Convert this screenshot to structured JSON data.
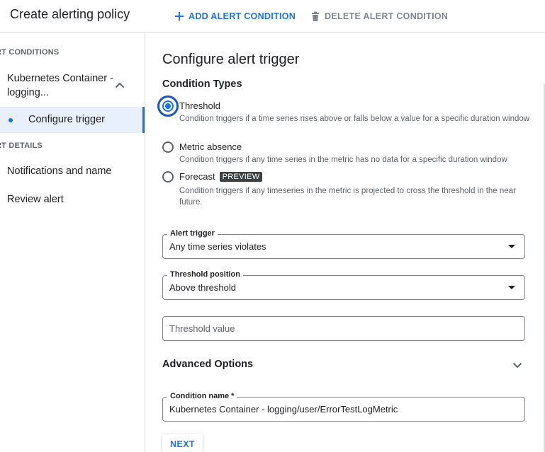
{
  "header": {
    "title": "Create alerting policy",
    "add_condition_label": "ADD ALERT CONDITION",
    "delete_condition_label": "DELETE ALERT CONDITION"
  },
  "sidebar": {
    "conditions_header": "RT CONDITIONS",
    "condition_name": "Kubernetes Container - logging...",
    "active_step": "Configure trigger",
    "details_header": "RT DETAILS",
    "items": [
      {
        "label": "Notifications and name"
      },
      {
        "label": "Review alert"
      }
    ]
  },
  "main": {
    "title": "Configure alert trigger",
    "condition_types_title": "Condition Types",
    "condition_types": [
      {
        "label": "Threshold",
        "description": "Condition triggers if a time series rises above or falls below a value for a specific duration window",
        "selected": true
      },
      {
        "label": "Metric absence",
        "description": "Condition triggers if any time series in the metric has no data for a specific duration window",
        "selected": false
      },
      {
        "label": "Forecast",
        "badge": "PREVIEW",
        "description": "Condition triggers if any timeseries in the metric is projected to cross the threshold in the near future.",
        "selected": false
      }
    ],
    "alert_trigger": {
      "label": "Alert trigger",
      "value": "Any time series violates"
    },
    "threshold_position": {
      "label": "Threshold position",
      "value": "Above threshold"
    },
    "threshold_value": {
      "placeholder": "Threshold value",
      "value": ""
    },
    "advanced_options_label": "Advanced Options",
    "condition_name": {
      "label": "Condition name *",
      "value": "Kubernetes Container - logging/user/ErrorTestLogMetric"
    },
    "next_label": "NEXT"
  },
  "colors": {
    "accent": "#1a73e8",
    "active_bg": "#e8f0fe",
    "badge_bg": "#3c4043",
    "muted_text": "#5f6368"
  },
  "icons": {
    "add": "plus-icon",
    "delete": "trash-icon",
    "collapse": "chevron-up-icon",
    "expand": "chevron-down-icon",
    "dropdown": "dropdown-arrow-icon"
  }
}
